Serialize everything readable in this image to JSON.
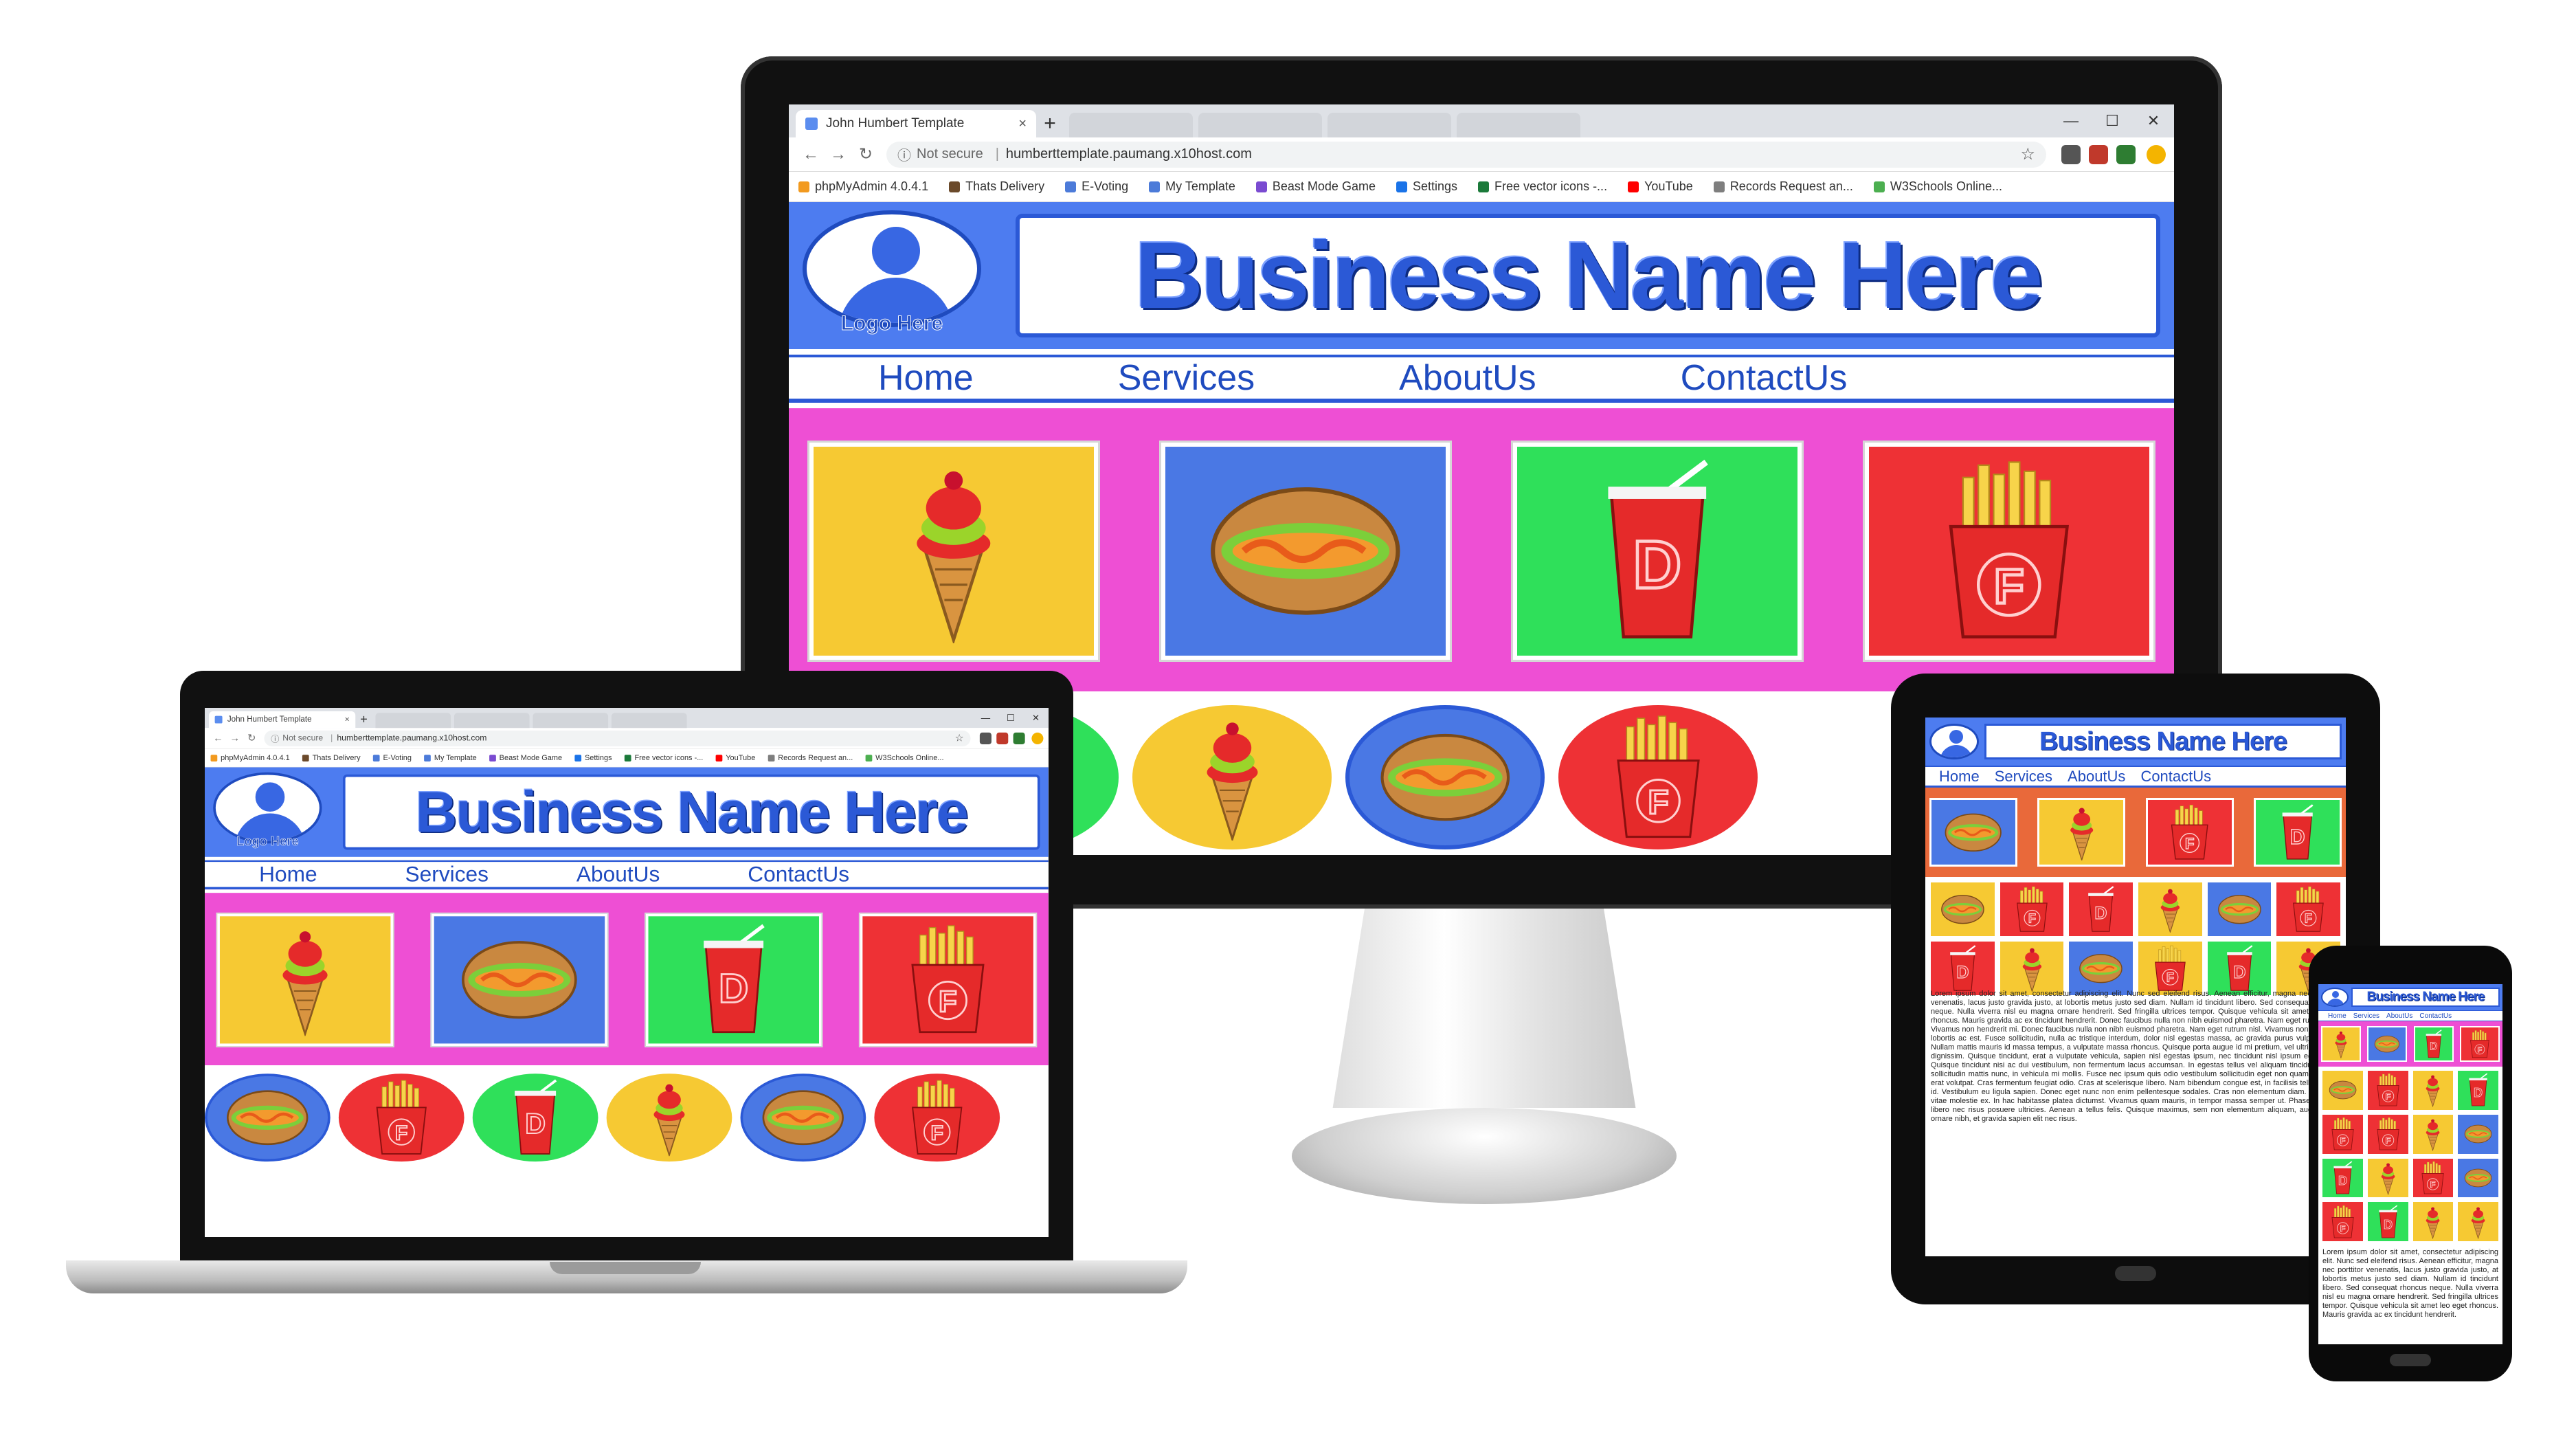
{
  "browser": {
    "tab_title": "John Humbert Template",
    "tab_close": "×",
    "new_tab": "+",
    "security_label": "Not secure",
    "url": "humberttemplate.paumang.x10host.com",
    "window_controls": [
      "—",
      "☐",
      "✕"
    ],
    "bookmarks": [
      {
        "label": "phpMyAdmin 4.0.4.1",
        "color": "#f29a1f"
      },
      {
        "label": "Thats Delivery",
        "color": "#6b4a2b"
      },
      {
        "label": "E-Voting",
        "color": "#4c7bd9"
      },
      {
        "label": "My Template",
        "color": "#4c7bd9"
      },
      {
        "label": "Beast Mode Game",
        "color": "#7a4bd1"
      },
      {
        "label": "Settings",
        "color": "#1a73e8"
      },
      {
        "label": "Free vector icons -...",
        "color": "#1b7a3a"
      },
      {
        "label": "YouTube",
        "color": "#ff0000"
      },
      {
        "label": "Records Request an...",
        "color": "#7e7e7e"
      },
      {
        "label": "W3Schools Online...",
        "color": "#4caf50"
      }
    ]
  },
  "site": {
    "logo_text": "Logo Here",
    "business_name": "Business Name Here",
    "nav": [
      "Home",
      "Services",
      "AboutUs",
      "ContactUs"
    ],
    "gallery": [
      {
        "item": "ice-cream",
        "bg": "#f6c933"
      },
      {
        "item": "hot-dog",
        "bg": "#4a78e4"
      },
      {
        "item": "drink",
        "bg": "#2fe05a"
      },
      {
        "item": "fries",
        "bg": "#ee3135"
      }
    ],
    "row2": [
      {
        "item": "fries",
        "bg": "#ee3135"
      },
      {
        "item": "drink",
        "bg": "#2fe05a"
      },
      {
        "item": "ice-cream",
        "bg": "#f6c933"
      },
      {
        "item": "hot-dog",
        "bg": "#4a78e4"
      },
      {
        "item": "fries",
        "bg": "#ee3135"
      }
    ],
    "laptop_row2": [
      {
        "item": "hot-dog",
        "bg": "#4a78e4"
      },
      {
        "item": "fries",
        "bg": "#ee3135"
      },
      {
        "item": "drink",
        "bg": "#2fe05a"
      },
      {
        "item": "ice-cream",
        "bg": "#f6c933"
      },
      {
        "item": "hot-dog",
        "bg": "#4a78e4"
      },
      {
        "item": "fries",
        "bg": "#ee3135"
      }
    ],
    "lorem": "Lorem ipsum dolor sit amet, consectetur adipiscing elit. Nunc sed eleifend risus. Aenean efficitur, magna nec porttitor venenatis, lacus justo gravida justo, at lobortis metus justo sed diam. Nullam id tincidunt libero. Sed consequat rhoncus neque. Nulla viverra nisl eu magna ornare hendrerit. Sed fringilla ultrices tempor. Quisque vehicula sit amet leo eget rhoncus. Mauris gravida ac ex tincidunt hendrerit. Donec faucibus nulla non nibh euismod pharetra. Nam eget rutrum nisl. Vivamus non hendrerit mi. Donec faucibus nulla non nibh euismod pharetra. Nam eget rutrum nisl. Vivamus non iaculis a, lobortis ac est. Fusce sollicitudin, nulla ac tristique interdum, dolor nisl egestas massa, ac gravida purus vulputate ex. Nullam mattis mauris id massa tempus, a vulputate massa rhoncus. Quisque porta augue id mi pretium, vel ultrices ligula dignissim. Quisque tincidunt, erat a vulputate vehicula, sapien nisl egestas ipsum, nec tincidunt nisl ipsum eget nunc. Quisque tincidunt nisi ac dui vestibulum, non fermentum lacus accumsan. In egestas tellus vel aliquam tincidunt. Nulla sollicitudin mattis nunc, in vehicula mi mollis. Fusce nec ipsum quis odio vestibulum sollicitudin eget non quam. Aliquam erat volutpat. Cras fermentum feugiat odio. Cras at scelerisque libero. Nam bibendum congue est, in facilisis tellus mattis id. Vestibulum eu ligula sapien. Donec eget nunc non enim pellentesque sodales. Cras non elementum diam. Curabitur vitae molestie ex. In hac habitasse platea dictumst. Vivamus quam mauris, in tempor massa semper ut. Phasellus vitae libero nec risus posuere ultricies. Aenean a tellus felis. Quisque maximus, sem non elementum aliquam, augue nunc ornare nibh, et gravida sapien elit nec risus.",
    "phone_lorem": "Lorem ipsum dolor sit amet, consectetur adipiscing elit. Nunc sed eleifend risus. Aenean efficitur, magna nec porttitor venenatis, lacus justo gravida justo, at lobortis metus justo sed diam. Nullam id tincidunt libero. Sed consequat rhoncus neque. Nulla viverra nisl eu magna ornare hendrerit. Sed fringilla ultrices tempor. Quisque vehicula sit amet leo eget rhoncus. Mauris gravida ac ex tincidunt hendrerit."
  }
}
